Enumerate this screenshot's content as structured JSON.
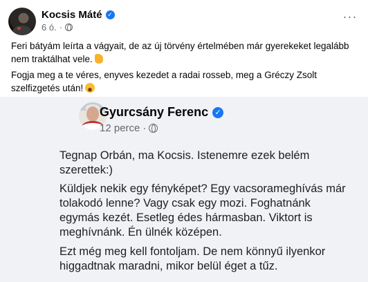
{
  "post": {
    "author": "Kocsis Máté",
    "time": "6 ó.",
    "separator": "·",
    "more": "···",
    "paragraphs": [
      "Feri bátyám leírta a vágyait, de az új törvény értelmében már gyerekeket legalább nem traktálhat vele.",
      "Fogja meg a te véres, enyves kezedet a radai rosseb, meg a Gréczy Zsolt szelfizgetés után!"
    ]
  },
  "screenshot": {
    "author": "Gyurcsány Ferenc",
    "time": "12 perce",
    "separator": "·",
    "paragraphs": [
      "Tegnap Orbán, ma Kocsis. Istenemre ezek belém szerettek:)",
      "Küldjek nekik egy fényképet? Egy vacsorameghívás már tolakodó lenne? Vagy csak egy mozi. Foghatnánk egymás kezét. Esetleg édes hármasban. Viktort is meghívnánk. Én ülnék középen.",
      "Ezt még meg kell fontoljam. De nem könnyű ilyenkor higgadtnak maradni, mikor belül éget a tűz."
    ]
  },
  "colors": {
    "accent": "#1877f2",
    "meta_text": "#65676b",
    "screenshot_bg": "#f0f2f5"
  },
  "icons": [
    "verified-badge-icon",
    "globe-icon",
    "more-options-icon",
    "thumbs-up-emoji",
    "laughing-emoji"
  ]
}
